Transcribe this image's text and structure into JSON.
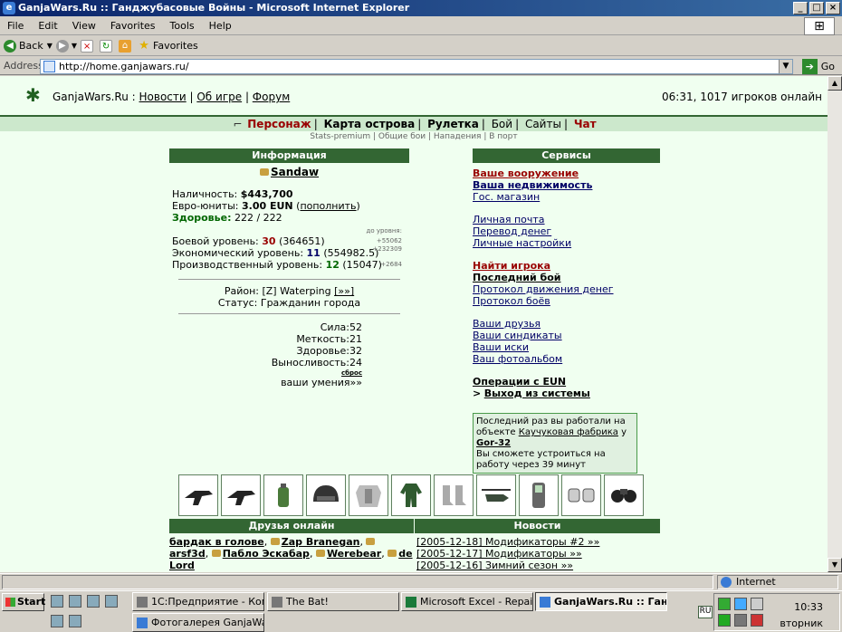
{
  "window": {
    "title": "GanjaWars.Ru :: Ганджубасовые Войны - Microsoft Internet Explorer"
  },
  "menu": [
    "File",
    "Edit",
    "View",
    "Favorites",
    "Tools",
    "Help"
  ],
  "toolbar": {
    "back": "Back",
    "favorites": "Favorites"
  },
  "address": {
    "label": "Address",
    "url": "http://home.ganjawars.ru/",
    "go": "Go"
  },
  "header": {
    "site": "GanjaWars.Ru",
    "sep": ":",
    "links": [
      "Новости",
      "Об игре",
      "Форум"
    ],
    "online": "06:31, 1017 игроков онлайн"
  },
  "nav": {
    "items": [
      "Персонаж",
      "Карта острова",
      "Рулетка",
      "Бой",
      "Сайты",
      "Чат"
    ],
    "sub": "Stats-premium | Общие бои | Нападения | В порт"
  },
  "info": {
    "title": "Информация",
    "user": "Sandaw",
    "cash_label": "Наличность:",
    "cash": "$443,700",
    "euro_label": "Евро-юниты:",
    "euro": "3.00 EUN",
    "euro_link": "пополнить",
    "health_label": "Здоровье:",
    "health": "222 / 222",
    "to_level": "до уровня:",
    "combat_label": "Боевой уровень:",
    "combat": "30",
    "combat_exp": "(364651)",
    "combat_need": "+55062",
    "econ_label": "Экономический уровень:",
    "econ": "11",
    "econ_exp": "(554982.5)",
    "econ_need": "+232309",
    "prod_label": "Производственный уровень:",
    "prod": "12",
    "prod_exp": "(15047)",
    "prod_need": "+2684",
    "district_label": "Район:",
    "district": "[Z] Waterping",
    "district_link": "[»»]",
    "status_label": "Статус:",
    "status": "Гражданин города",
    "stats": [
      {
        "k": "Сила:",
        "v": "52"
      },
      {
        "k": "Меткость:",
        "v": "21"
      },
      {
        "k": "Здоровье:",
        "v": "32"
      },
      {
        "k": "Выносливость:",
        "v": "24"
      }
    ],
    "reset": "сброс",
    "skills": "ваши умения»»"
  },
  "services": {
    "title": "Сервисы",
    "g1": [
      "Ваше вооружение",
      "Ваша недвижимость",
      "Гос. магазин"
    ],
    "g2": [
      "Личная почта",
      "Перевод денег",
      "Личные настройки"
    ],
    "g3": [
      "Найти игрока",
      "Последний бой",
      "Протокол движения денег",
      "Протокол боёв"
    ],
    "g4": [
      "Ваши друзья",
      "Ваши синдикаты",
      "Ваши иски",
      "Ваш фотоальбом"
    ],
    "eun": "Операции с EUN",
    "exit_prefix": ">",
    "exit": "Выход из системы",
    "work": {
      "t1": "Последний раз вы работали на объекте",
      "place": "Каучуковая фабрика",
      "t2": "у",
      "owner": "Gor-32",
      "t3": "Вы сможете устроиться на работу через 39 минут"
    }
  },
  "items": [
    "p90-icon",
    "p90-icon",
    "grenade-icon",
    "helmet-icon",
    "armor-icon",
    "suit-icon",
    "boots-icon",
    "helicopter-icon",
    "phone-icon",
    "pads-icon",
    "goggles-icon"
  ],
  "friends": {
    "title": "Друзья онлайн",
    "list": [
      "бардак в голове",
      "Zap Branegan",
      "arsf3d",
      "Пабло Эскабар",
      "Werebear",
      "de Lord"
    ]
  },
  "news": {
    "title": "Новости",
    "list": [
      "[2005-12-18] Модификаторы #2 »»",
      "[2005-12-17] Модификаторы »»",
      "[2005-12-16] Зимний сезон »»"
    ]
  },
  "statusbar": {
    "zone": "Internet"
  },
  "taskbar": {
    "start": "Start",
    "tasks": [
      "1С:Предприятие - Комп...",
      "The Bat!",
      "Microsoft Excel - Repair....",
      "GanjaWars.Ru :: Ганд...",
      "Фотогалерея GanjaWar..."
    ],
    "lang": "RU",
    "time": "10:33",
    "day": "вторник"
  },
  "colors": {
    "page_bg": "#f0fff0",
    "header_green": "#336633",
    "accent_red": "#990000"
  }
}
